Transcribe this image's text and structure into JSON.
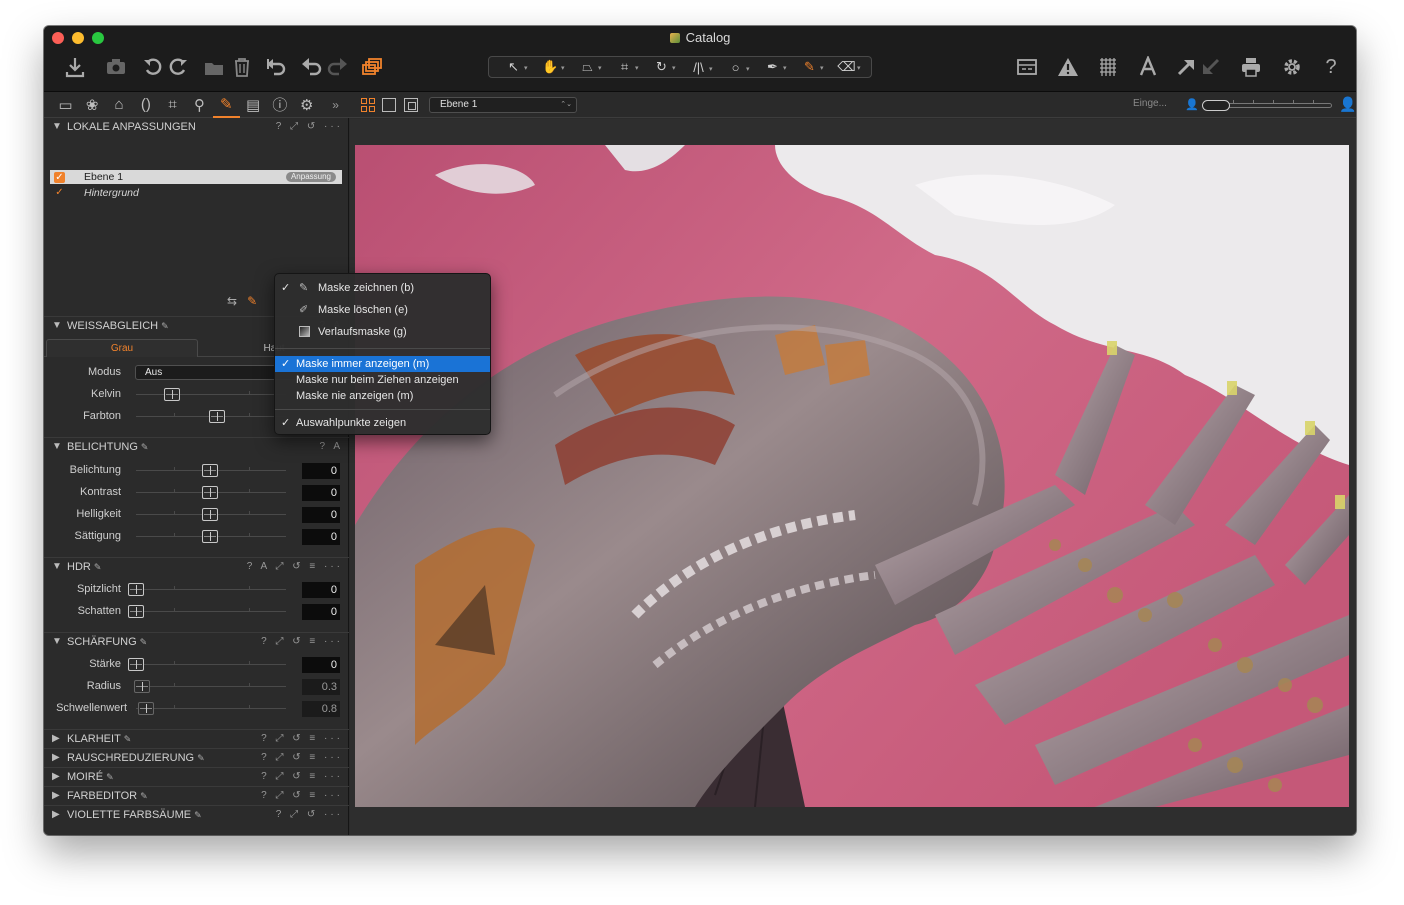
{
  "window": {
    "title": "Catalog"
  },
  "toolbar": {
    "left_icons": [
      "import-icon",
      "camera-icon",
      "rotate-left-icon",
      "rotate-right-icon",
      "move-to-folder-icon",
      "trash-icon",
      "undo-all-icon",
      "undo-icon",
      "redo-icon",
      "variants-icon"
    ],
    "cursor_tools": [
      "select-cursor-icon",
      "hand-pan-icon",
      "keystone-icon",
      "crop-icon",
      "rotate-cursor-icon",
      "straighten-icon",
      "circle-spot-icon",
      "color-picker-icon",
      "brush-draw-icon",
      "eraser-icon"
    ],
    "right_icons": [
      "compare-icon",
      "exposure-warning-icon",
      "grid-icon",
      "text-annotation-icon",
      "copy-adjustments-icon",
      "apply-adjustments-icon",
      "print-icon",
      "settings-icon",
      "help-icon"
    ]
  },
  "viewbar": {
    "layer_select": "Ebene 1",
    "filter_label": "Einge..."
  },
  "panel": {
    "local": {
      "title": "LOKALE ANPASSUNGEN",
      "tools": "? ⤢ ↺ ···",
      "layers": [
        {
          "name": "Ebene 1",
          "tag": "Anpassung",
          "checked": true,
          "selected": true
        },
        {
          "name": "Hintergrund",
          "checked": true,
          "selected": false
        }
      ]
    },
    "wb": {
      "title": "WEISSABGLEICH",
      "tools": "? A",
      "tab_active": "Grau",
      "tab_other": "Haut",
      "mode_label": "Modus",
      "mode_value": "Aus",
      "kelvin_label": "Kelvin",
      "farbton_label": "Farbton"
    },
    "exposure": {
      "title": "BELICHTUNG",
      "tools": "? A",
      "rows": [
        {
          "label": "Belichtung",
          "value": "0"
        },
        {
          "label": "Kontrast",
          "value": "0"
        },
        {
          "label": "Helligkeit",
          "value": "0"
        },
        {
          "label": "Sättigung",
          "value": "0"
        }
      ]
    },
    "hdr": {
      "title": "HDR",
      "tools": "? A ⤢ ↺ ≡ ···",
      "rows": [
        {
          "label": "Spitzlicht",
          "value": "0"
        },
        {
          "label": "Schatten",
          "value": "0"
        }
      ]
    },
    "sharp": {
      "title": "SCHÄRFUNG",
      "tools": "? ⤢ ↺ ≡ ···",
      "rows": [
        {
          "label": "Stärke",
          "value": "0"
        },
        {
          "label": "Radius",
          "value": "0.3"
        },
        {
          "label": "Schwellenwert",
          "value": "0.8"
        }
      ]
    },
    "collapsed": [
      {
        "title": "KLARHEIT",
        "tools": "? ⤢ ↺ ≡ ···"
      },
      {
        "title": "RAUSCHREDUZIERUNG",
        "tools": "? ⤢ ↺ ≡ ···"
      },
      {
        "title": "MOIRÉ",
        "tools": "? ⤢ ↺ ≡ ···"
      },
      {
        "title": "FARBEDITOR",
        "tools": "? ⤢ ↺ ≡ ···"
      },
      {
        "title": "VIOLETTE FARBSÄUME",
        "tools": "? ⤢ ↺ ···"
      }
    ]
  },
  "menu": {
    "items": [
      {
        "label": "Maske zeichnen (b)",
        "checked": true,
        "icon": "brush-icon"
      },
      {
        "label": "Maske löschen (e)",
        "checked": false,
        "icon": "eraser-icon"
      },
      {
        "label": "Verlaufsmaske (g)",
        "checked": false,
        "icon": "gradient-mask-icon"
      },
      {
        "label": "Maske immer anzeigen (m)",
        "checked": true,
        "highlighted": true
      },
      {
        "label": "Maske nur beim Ziehen anzeigen",
        "checked": false
      },
      {
        "label": "Maske nie anzeigen (m)",
        "checked": false
      },
      {
        "label": "Auswahlpunkte zeigen",
        "checked": true
      }
    ]
  },
  "colors": {
    "accent": "#f0822c",
    "highlight": "#1a73d6",
    "mask_overlay": "#c9607e"
  }
}
